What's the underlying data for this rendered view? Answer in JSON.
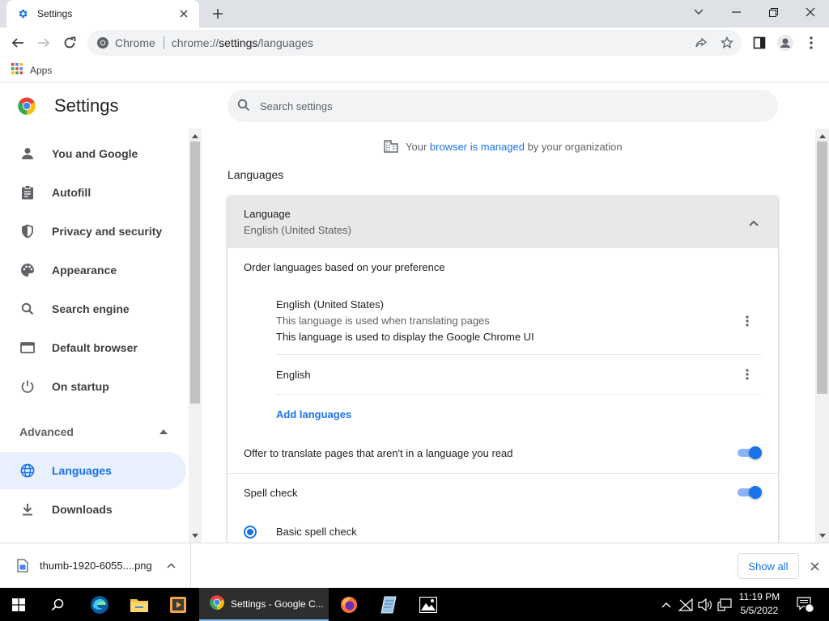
{
  "window": {
    "tab_title": "Settings",
    "controls": {
      "minimize": "minimize",
      "restore": "restore",
      "close": "close"
    }
  },
  "toolbar": {
    "site_chip": "Chrome",
    "url_prefix": "chrome://",
    "url_host": "settings",
    "url_path": "/languages"
  },
  "bookmarks": {
    "apps_label": "Apps"
  },
  "header": {
    "title": "Settings",
    "search_placeholder": "Search settings"
  },
  "sidebar": {
    "items": [
      {
        "label": "You and Google",
        "icon": "person-icon"
      },
      {
        "label": "Autofill",
        "icon": "clipboard-icon"
      },
      {
        "label": "Privacy and security",
        "icon": "shield-icon"
      },
      {
        "label": "Appearance",
        "icon": "palette-icon"
      },
      {
        "label": "Search engine",
        "icon": "search-icon"
      },
      {
        "label": "Default browser",
        "icon": "browser-icon"
      },
      {
        "label": "On startup",
        "icon": "power-icon"
      }
    ],
    "advanced_label": "Advanced",
    "advanced_items": [
      {
        "label": "Languages",
        "icon": "globe-icon",
        "active": true
      },
      {
        "label": "Downloads",
        "icon": "download-icon"
      }
    ]
  },
  "main": {
    "managed": {
      "prefix": "Your ",
      "link": "browser is managed",
      "suffix": " by your organization"
    },
    "section_title": "Languages",
    "language_card": {
      "title": "Language",
      "value": "English (United States)"
    },
    "order_label": "Order languages based on your preference",
    "languages": [
      {
        "name": "English (United States)",
        "note1": "This language is used when translating pages",
        "note2": "This language is used to display the Google Chrome UI"
      },
      {
        "name": "English"
      }
    ],
    "add_languages": "Add languages",
    "offer_translate": {
      "label": "Offer to translate pages that aren't in a language you read",
      "enabled": true
    },
    "spell_check": {
      "label": "Spell check",
      "enabled": true
    },
    "basic_spell_check": {
      "label": "Basic spell check",
      "selected": true
    }
  },
  "download_shelf": {
    "file_name": "thumb-1920-6055....png",
    "show_all": "Show all"
  },
  "taskbar": {
    "chrome_label": "Settings - Google C...",
    "time": "11:19 PM",
    "date": "5/5/2022",
    "notification_count": "1"
  },
  "colors": {
    "accent": "#1a73e8",
    "active_nav_bg": "#e8f0fe",
    "toggle_track": "#8ab4f8"
  }
}
